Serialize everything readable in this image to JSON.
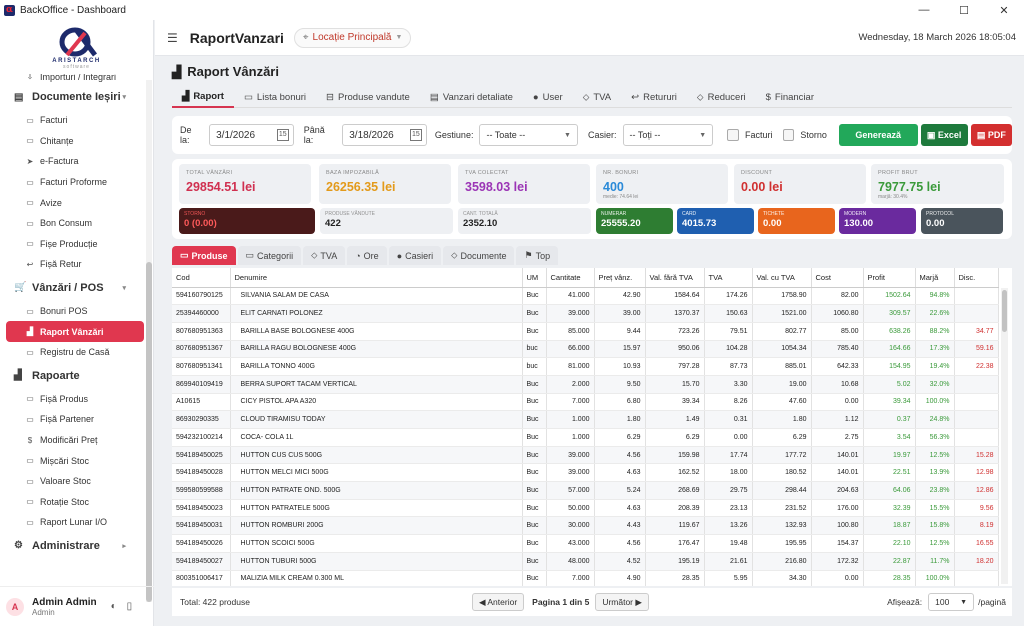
{
  "window": {
    "title": "BackOffice - Dashboard"
  },
  "brand": {
    "name": "ARISTARCH",
    "sub": "software"
  },
  "sidebar": {
    "items": [
      {
        "label": "Importuri / Integrari",
        "icon": "import-icon",
        "type": "item"
      },
      {
        "label": "Documente Ieșiri",
        "icon": "documents-icon",
        "type": "section"
      },
      {
        "label": "Facturi",
        "icon": "document-icon",
        "type": "item"
      },
      {
        "label": "Chitanțe",
        "icon": "receipt-icon",
        "type": "item"
      },
      {
        "label": "e-Factura",
        "icon": "send-icon",
        "type": "item"
      },
      {
        "label": "Facturi Proforme",
        "icon": "document-icon",
        "type": "item"
      },
      {
        "label": "Avize",
        "icon": "document-icon",
        "type": "item"
      },
      {
        "label": "Bon Consum",
        "icon": "document-icon",
        "type": "item"
      },
      {
        "label": "Fișe Producție",
        "icon": "document-icon",
        "type": "item"
      },
      {
        "label": "Fișă Retur",
        "icon": "return-icon",
        "type": "item"
      },
      {
        "label": "Vânzări / POS",
        "icon": "cart-icon",
        "type": "section"
      },
      {
        "label": "Bonuri POS",
        "icon": "receipt-icon",
        "type": "item"
      },
      {
        "label": "Raport Vânzări",
        "icon": "chart-icon",
        "type": "active"
      },
      {
        "label": "Registru de Casă",
        "icon": "register-icon",
        "type": "item"
      },
      {
        "label": "Rapoarte",
        "icon": "chart-icon",
        "type": "section"
      },
      {
        "label": "Fișă Produs",
        "icon": "document-icon",
        "type": "item"
      },
      {
        "label": "Fișă Partener",
        "icon": "document-icon",
        "type": "item"
      },
      {
        "label": "Modificări Preț",
        "icon": "dollar-icon",
        "type": "item"
      },
      {
        "label": "Mișcări Stoc",
        "icon": "document-icon",
        "type": "item"
      },
      {
        "label": "Valoare Stoc",
        "icon": "document-icon",
        "type": "item"
      },
      {
        "label": "Rotație Stoc",
        "icon": "document-icon",
        "type": "item"
      },
      {
        "label": "Raport Lunar I/O",
        "icon": "document-icon",
        "type": "item"
      },
      {
        "label": "Administrare",
        "icon": "gear-icon",
        "type": "section"
      }
    ],
    "user": {
      "initial": "A",
      "name": "Admin Admin",
      "role": "Admin"
    }
  },
  "topbar": {
    "title": "RaportVanzari",
    "location": "Locație Principală",
    "datetime": "Wednesday, 18 March 2026   18:05:04"
  },
  "page": {
    "title": "Raport Vânzări"
  },
  "tabs": [
    "Raport",
    "Lista bonuri",
    "Produse vandute",
    "Vanzari detaliate",
    "User",
    "TVA",
    "Retururi",
    "Reduceri",
    "Financiar"
  ],
  "filters": {
    "from_label": "De la:",
    "from": "3/1/2026",
    "to_label": "Până la:",
    "to": "3/18/2026",
    "gestiune_label": "Gestiune:",
    "gestiune": "-- Toate --",
    "casier_label": "Casier:",
    "casier": "-- Toți --",
    "facturi_label": "Facturi",
    "storno_label": "Storno",
    "generate": "Generează",
    "excel": "Excel",
    "pdf": "PDF"
  },
  "kpis": [
    {
      "label": "TOTAL VÂNZĂRI",
      "value": "29854.51 lei",
      "color": "#d03050",
      "sub": ""
    },
    {
      "label": "BAZA IMPOZABILĂ",
      "value": "26256.35 lei",
      "color": "#e39a1a",
      "sub": ""
    },
    {
      "label": "TVA COLECTAT",
      "value": "3598.03 lei",
      "color": "#9b35b5",
      "sub": ""
    },
    {
      "label": "NR. BONURI",
      "value": "400",
      "color": "#2a8ad8",
      "sub": "medie: 74.64 lei"
    },
    {
      "label": "DISCOUNT",
      "value": "0.00 lei",
      "color": "#d03030",
      "sub": ""
    },
    {
      "label": "PROFIT BRUT",
      "value": "7977.75 lei",
      "color": "#3a9a3a",
      "sub": "marjă: 30.4%"
    }
  ],
  "minis": [
    {
      "label": "STORNO",
      "value": "0 (0.00)",
      "bg": "#4a1a1a",
      "fg": "#ff5a5a"
    },
    {
      "label": "PRODUSE VÂNDUTE",
      "value": "422",
      "bg": "#eef0f3",
      "fg": "#222"
    },
    {
      "label": "CANT. TOTALĂ",
      "value": "2352.10",
      "bg": "#eef0f3",
      "fg": "#222"
    },
    {
      "label": "NUMERAR",
      "value": "25555.20",
      "bg": "#2e7d32",
      "fg": "#fff"
    },
    {
      "label": "CARD",
      "value": "4015.73",
      "bg": "#1f5fb0",
      "fg": "#fff"
    },
    {
      "label": "TICHETE",
      "value": "0.00",
      "bg": "#e8651d",
      "fg": "#fff"
    },
    {
      "label": "MODERN",
      "value": "130.00",
      "bg": "#6a2a9e",
      "fg": "#fff"
    },
    {
      "label": "PROTOCOL",
      "value": "0.00",
      "bg": "#4a545c",
      "fg": "#fff"
    }
  ],
  "subtabs": [
    "Produse",
    "Categorii",
    "TVA",
    "Ore",
    "Casieri",
    "Documente",
    "Top"
  ],
  "table": {
    "columns": [
      "Cod",
      "Denumire",
      "UM",
      "Cantitate",
      "Preț vânz.",
      "Val. fără TVA",
      "TVA",
      "Val. cu TVA",
      "Cost",
      "Profit",
      "Marjă",
      "Disc."
    ],
    "rows": [
      [
        "594160790125",
        "SILVANIA SALAM DE CASA",
        "Buc",
        "41.000",
        "42.90",
        "1584.64",
        "174.26",
        "1758.90",
        "82.00",
        "1502.64",
        "94.8%",
        ""
      ],
      [
        "25394460000",
        "ELIT CARNATI POLONEZ",
        "Buc",
        "39.000",
        "39.00",
        "1370.37",
        "150.63",
        "1521.00",
        "1060.80",
        "309.57",
        "22.6%",
        ""
      ],
      [
        "807680951363",
        "BARILLA BASE BOLOGNESE 400G",
        "Buc",
        "85.000",
        "9.44",
        "723.26",
        "79.51",
        "802.77",
        "85.00",
        "638.26",
        "88.2%",
        "34.77"
      ],
      [
        "807680951367",
        "BARILLA RAGU BOLOGNESE 400G",
        "buc",
        "66.000",
        "15.97",
        "950.06",
        "104.28",
        "1054.34",
        "785.40",
        "164.66",
        "17.3%",
        "59.16"
      ],
      [
        "807680951341",
        "BARILLA TONNO 400G",
        "buc",
        "81.000",
        "10.93",
        "797.28",
        "87.73",
        "885.01",
        "642.33",
        "154.95",
        "19.4%",
        "22.38"
      ],
      [
        "869940109419",
        "BERRA SUPORT TACAM VERTICAL",
        "Buc",
        "2.000",
        "9.50",
        "15.70",
        "3.30",
        "19.00",
        "10.68",
        "5.02",
        "32.0%",
        ""
      ],
      [
        "A10615",
        "CICY PISTOL APA A320",
        "Buc",
        "7.000",
        "6.80",
        "39.34",
        "8.26",
        "47.60",
        "0.00",
        "39.34",
        "100.0%",
        ""
      ],
      [
        "86930290335",
        "CLOUD TIRAMISU TODAY",
        "Buc",
        "1.000",
        "1.80",
        "1.49",
        "0.31",
        "1.80",
        "1.12",
        "0.37",
        "24.8%",
        ""
      ],
      [
        "594232100214",
        "COCA- COLA 1L",
        "Buc",
        "1.000",
        "6.29",
        "6.29",
        "0.00",
        "6.29",
        "2.75",
        "3.54",
        "56.3%",
        ""
      ],
      [
        "594189450025",
        "HUTTON CUS CUS 500G",
        "Buc",
        "39.000",
        "4.56",
        "159.98",
        "17.74",
        "177.72",
        "140.01",
        "19.97",
        "12.5%",
        "15.28"
      ],
      [
        "594189450028",
        "HUTTON MELCI MICI 500G",
        "Buc",
        "39.000",
        "4.63",
        "162.52",
        "18.00",
        "180.52",
        "140.01",
        "22.51",
        "13.9%",
        "12.98"
      ],
      [
        "599580599588",
        "HUTTON PATRATE OND. 500G",
        "Buc",
        "57.000",
        "5.24",
        "268.69",
        "29.75",
        "298.44",
        "204.63",
        "64.06",
        "23.8%",
        "12.86"
      ],
      [
        "594189450023",
        "HUTTON PATRATELE 500G",
        "Buc",
        "50.000",
        "4.63",
        "208.39",
        "23.13",
        "231.52",
        "176.00",
        "32.39",
        "15.5%",
        "9.56"
      ],
      [
        "594189450031",
        "HUTTON ROMBURI 200G",
        "Buc",
        "30.000",
        "4.43",
        "119.67",
        "13.26",
        "132.93",
        "100.80",
        "18.87",
        "15.8%",
        "8.19"
      ],
      [
        "594189450026",
        "HUTTON SCOICI 500G",
        "Buc",
        "43.000",
        "4.56",
        "176.47",
        "19.48",
        "195.95",
        "154.37",
        "22.10",
        "12.5%",
        "16.55"
      ],
      [
        "594189450027",
        "HUTTON TUBURI 500G",
        "Buc",
        "48.000",
        "4.52",
        "195.19",
        "21.61",
        "216.80",
        "172.32",
        "22.87",
        "11.7%",
        "18.20"
      ],
      [
        "800351006417",
        "MALIZIA MILK CREAM 0.300 ML",
        "Buc",
        "7.000",
        "4.90",
        "28.35",
        "5.95",
        "34.30",
        "0.00",
        "28.35",
        "100.0%",
        ""
      ]
    ]
  },
  "footer": {
    "total": "Total: 422 produse",
    "prev": "◀ Anterior",
    "page": "Pagina 1 din 5",
    "next": "Următor ▶",
    "show_label": "Afișează:",
    "per_page": "100",
    "per_suffix": "/pagină"
  }
}
